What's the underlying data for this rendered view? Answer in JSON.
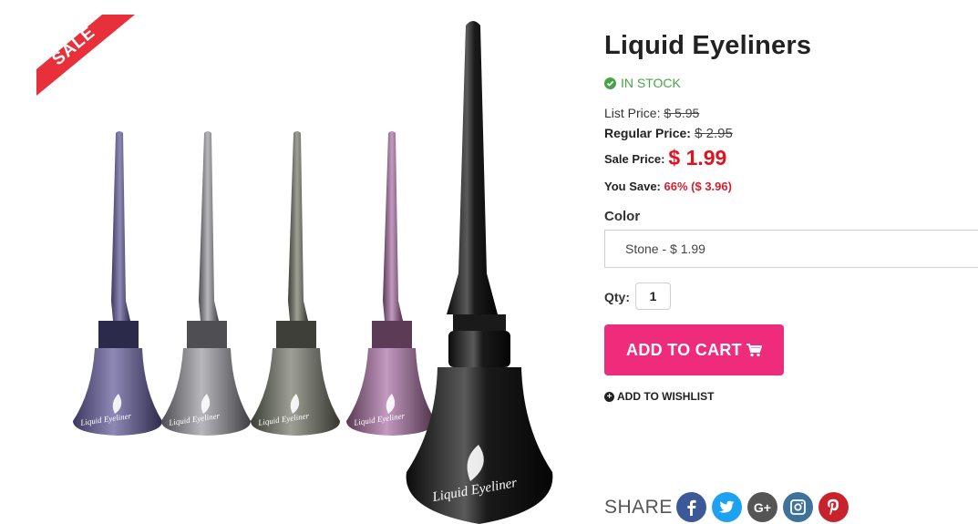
{
  "sale_badge": "SALE",
  "product": {
    "title": "Liquid Eyeliners",
    "stock": "IN STOCK",
    "bottle_label": "Liquid Eyeliner"
  },
  "pricing": {
    "list_label": "List Price:",
    "list_value": "$ 5.95",
    "regular_label": "Regular Price:",
    "regular_value": "$ 2.95",
    "sale_label": "Sale Price:",
    "sale_value": "$ 1.99",
    "save_label": "You Save:",
    "save_value": "66% ($ 3.96)"
  },
  "options": {
    "color_label": "Color",
    "color_selected": "Stone - $ 1.99",
    "qty_label": "Qty:",
    "qty_value": "1"
  },
  "actions": {
    "add_to_cart": "ADD TO CART",
    "add_to_wishlist": "ADD TO WISHLIST"
  },
  "share": {
    "label": "SHARE",
    "icons": [
      "facebook-icon",
      "twitter-icon",
      "google-plus-icon",
      "instagram-icon",
      "pinterest-icon"
    ],
    "colors": [
      "#3b5998",
      "#1da1f2",
      "#555555",
      "#3f729b",
      "#c8232c"
    ]
  },
  "colors": {
    "in_stock": "#46a546",
    "sale_price": "#e0121f",
    "cart_button": "#ef2b7c",
    "sale_ribbon": "#e8303a"
  }
}
